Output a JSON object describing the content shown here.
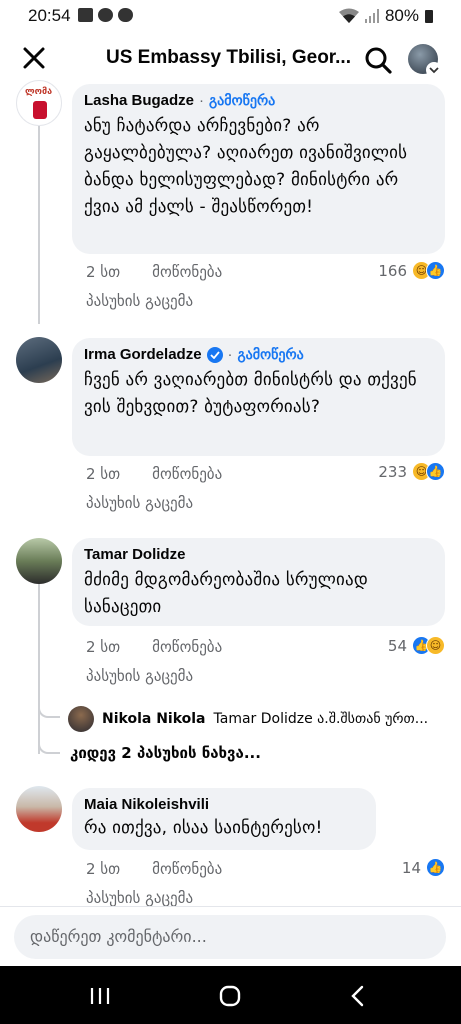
{
  "status": {
    "time": "20:54",
    "battery": "80%"
  },
  "header": {
    "title": "US Embassy Tbilisi, Geor..."
  },
  "comments": [
    {
      "author": "Lasha Bugadze",
      "follow": "გამოწერა",
      "text": "ანუ ჩატარდა არჩევნები? არ გაყალბებულა? აღიარეთ ივანიშვილის ბანდა ხელისუფლებად? მინისტრი არ ქვია ამ ქალს - შეასწორეთ!",
      "time": "2 სთ",
      "like": "მოწონება",
      "reply": "პასუხის გაცემა",
      "reactions": "166"
    },
    {
      "author": "Irma Gordeladze",
      "follow": "გამოწერა",
      "text": "ჩვენ არ ვაღიარებთ მინისტრს და თქვენ ვის შეხვდით? ბუტაფორიას?",
      "time": "2 სთ",
      "like": "მოწონება",
      "reply": "პასუხის გაცემა",
      "reactions": "233"
    },
    {
      "author": "Tamar Dolidze",
      "text": "მძიმე მდგომარეობაშია სრულიად სანაცეთი",
      "time": "2 სთ",
      "like": "მოწონება",
      "reply": "პასუხის გაცემა",
      "reactions": "54"
    },
    {
      "author": "Maia Nikoleishvili",
      "text": "რა ითქვა, ისაა საინტერესო!",
      "time": "2 სთ",
      "like": "მოწონება",
      "reply": "პასუხის გაცემა",
      "reactions": "14"
    }
  ],
  "reply_preview": {
    "author": "Nikola Nikola",
    "text": "Tamar Dolidze ა.შ.შსთან ურთ..."
  },
  "view_more": "კიდევ 2 პასუხის ნახვა...",
  "composer": {
    "placeholder": "დაწერეთ კომენტარი..."
  },
  "colors": {
    "accent": "#1877f2",
    "bubble": "#f0f2f5",
    "haha": "#f7b928"
  }
}
